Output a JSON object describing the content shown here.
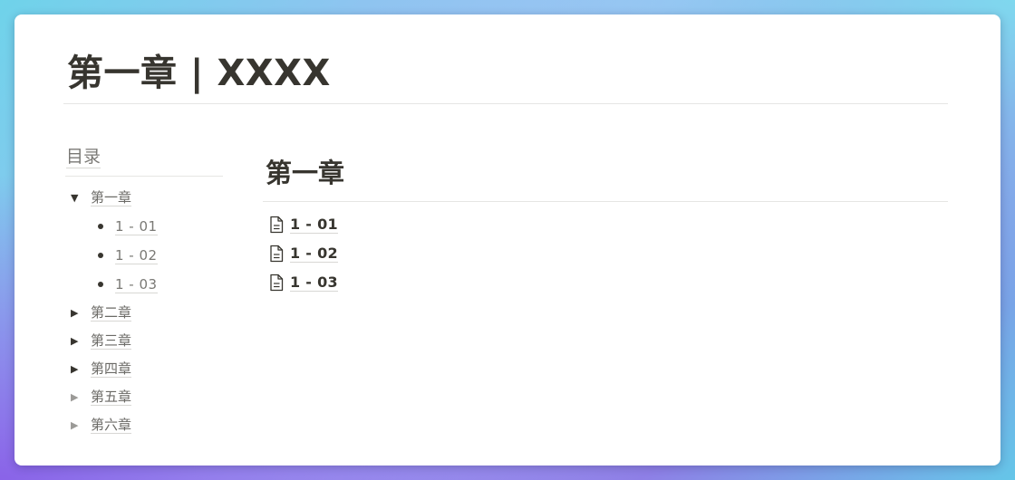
{
  "page": {
    "title": "第一章 | XXXX"
  },
  "toc": {
    "heading": "目录",
    "chapters": [
      {
        "label": "第一章",
        "expanded": true,
        "children": [
          "1 - 01",
          "1 - 02",
          "1 - 03"
        ]
      },
      {
        "label": "第二章",
        "expanded": false
      },
      {
        "label": "第三章",
        "expanded": false
      },
      {
        "label": "第四章",
        "expanded": false
      },
      {
        "label": "第五章",
        "expanded": false
      },
      {
        "label": "第六章",
        "expanded": false
      }
    ]
  },
  "main": {
    "section_title": "第一章",
    "pages": [
      "1 - 01",
      "1 - 02",
      "1 - 03"
    ]
  },
  "icons": {
    "expanded": "triangle-down-icon",
    "collapsed": "triangle-right-icon",
    "page": "document-icon",
    "bullet": "bullet-dot-icon"
  },
  "colors": {
    "text": "#37352f",
    "muted": "#7a7975",
    "divider": "#e6e6e4"
  }
}
